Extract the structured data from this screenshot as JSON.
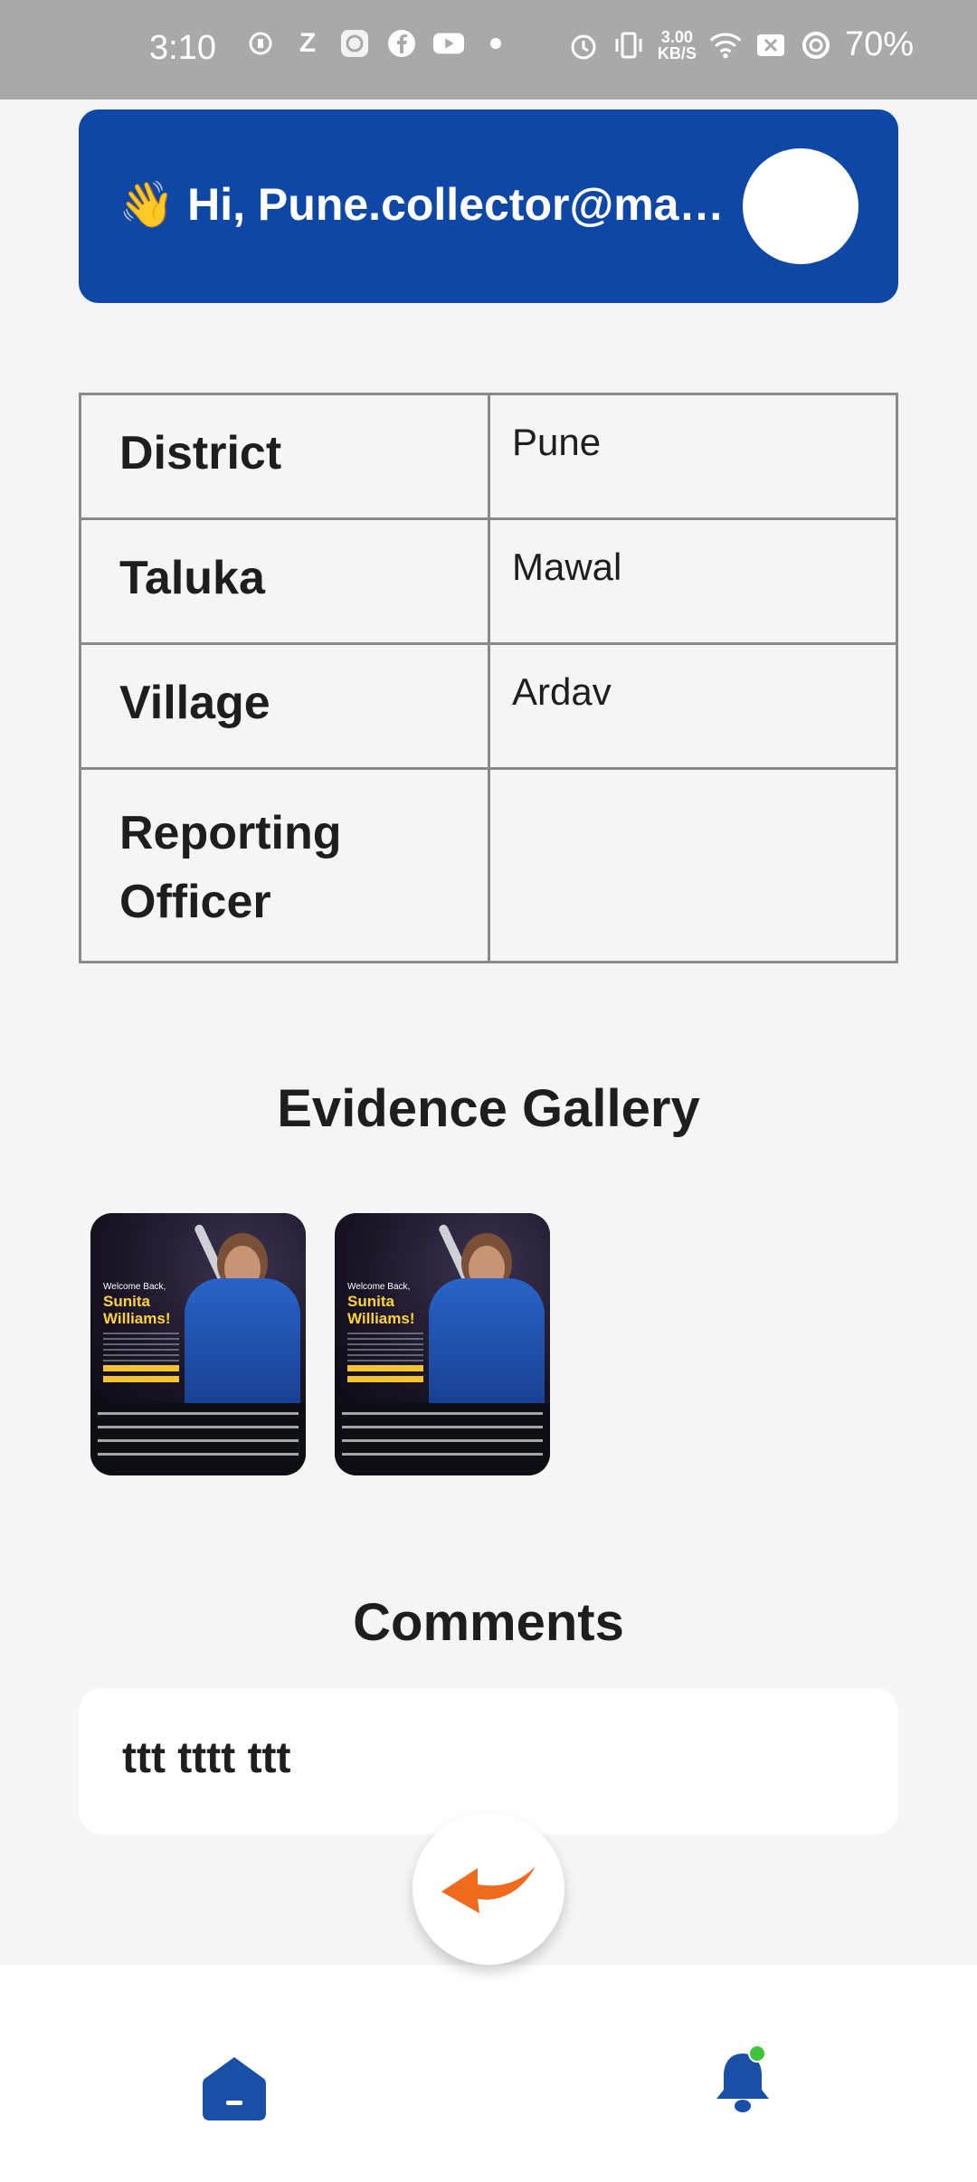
{
  "status_bar": {
    "time": "3:10",
    "net_speed_value": "3.00",
    "net_speed_unit": "KB/S",
    "battery": "70%",
    "icons": [
      "phone-icon",
      "z-app-icon",
      "camera-app-icon",
      "facebook-icon",
      "youtube-icon",
      "dot-icon",
      "alarm-icon",
      "vibrate-icon",
      "wifi-icon",
      "sim-x-icon",
      "battery-saver-icon"
    ]
  },
  "header": {
    "greeting": "👋 Hi, Pune.collector@maharashtra.gov.in"
  },
  "details": [
    {
      "label": "District",
      "value": "Pune"
    },
    {
      "label": "Taluka",
      "value": "Mawal"
    },
    {
      "label": "Village",
      "value": "Ardav"
    },
    {
      "label": "Reporting Officer",
      "value": ""
    }
  ],
  "gallery": {
    "title": "Evidence Gallery",
    "images": [
      {
        "welcome": "Welcome Back,",
        "name": "Sunita Williams!"
      },
      {
        "welcome": "Welcome Back,",
        "name": "Sunita Williams!"
      }
    ]
  },
  "comments": {
    "title": "Comments",
    "text": "ttt tttt ttt"
  },
  "colors": {
    "primary": "#0f47a6",
    "accent_orange": "#f06a1d",
    "nav_blue": "#1a4fa8",
    "notification_dot": "#3cc43c"
  },
  "bottom_nav": {
    "items": [
      "home-icon",
      "bell-icon"
    ]
  }
}
